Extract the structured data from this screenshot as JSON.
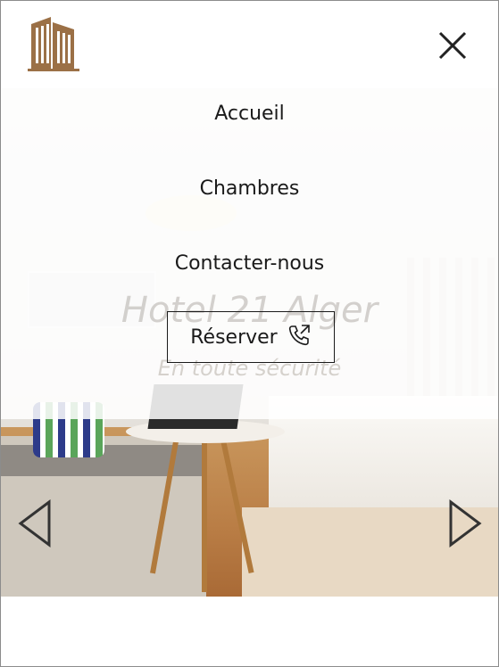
{
  "header": {
    "logo_icon": "hotel-building-icon",
    "close_icon": "close-icon"
  },
  "nav": {
    "items": [
      {
        "label": "Accueil"
      },
      {
        "label": "Chambres"
      },
      {
        "label": "Contacter-nous"
      }
    ],
    "reserve": {
      "label": "Réserver",
      "icon": "phone-call-icon"
    }
  },
  "hero": {
    "title": "Hotel 21 Alger",
    "subtitle": "En toute sécurité",
    "prev_icon": "chevron-left-icon",
    "next_icon": "chevron-right-icon"
  },
  "colors": {
    "logo": "#9b7046",
    "text": "#1a1a1a",
    "arrow": "#333333"
  }
}
